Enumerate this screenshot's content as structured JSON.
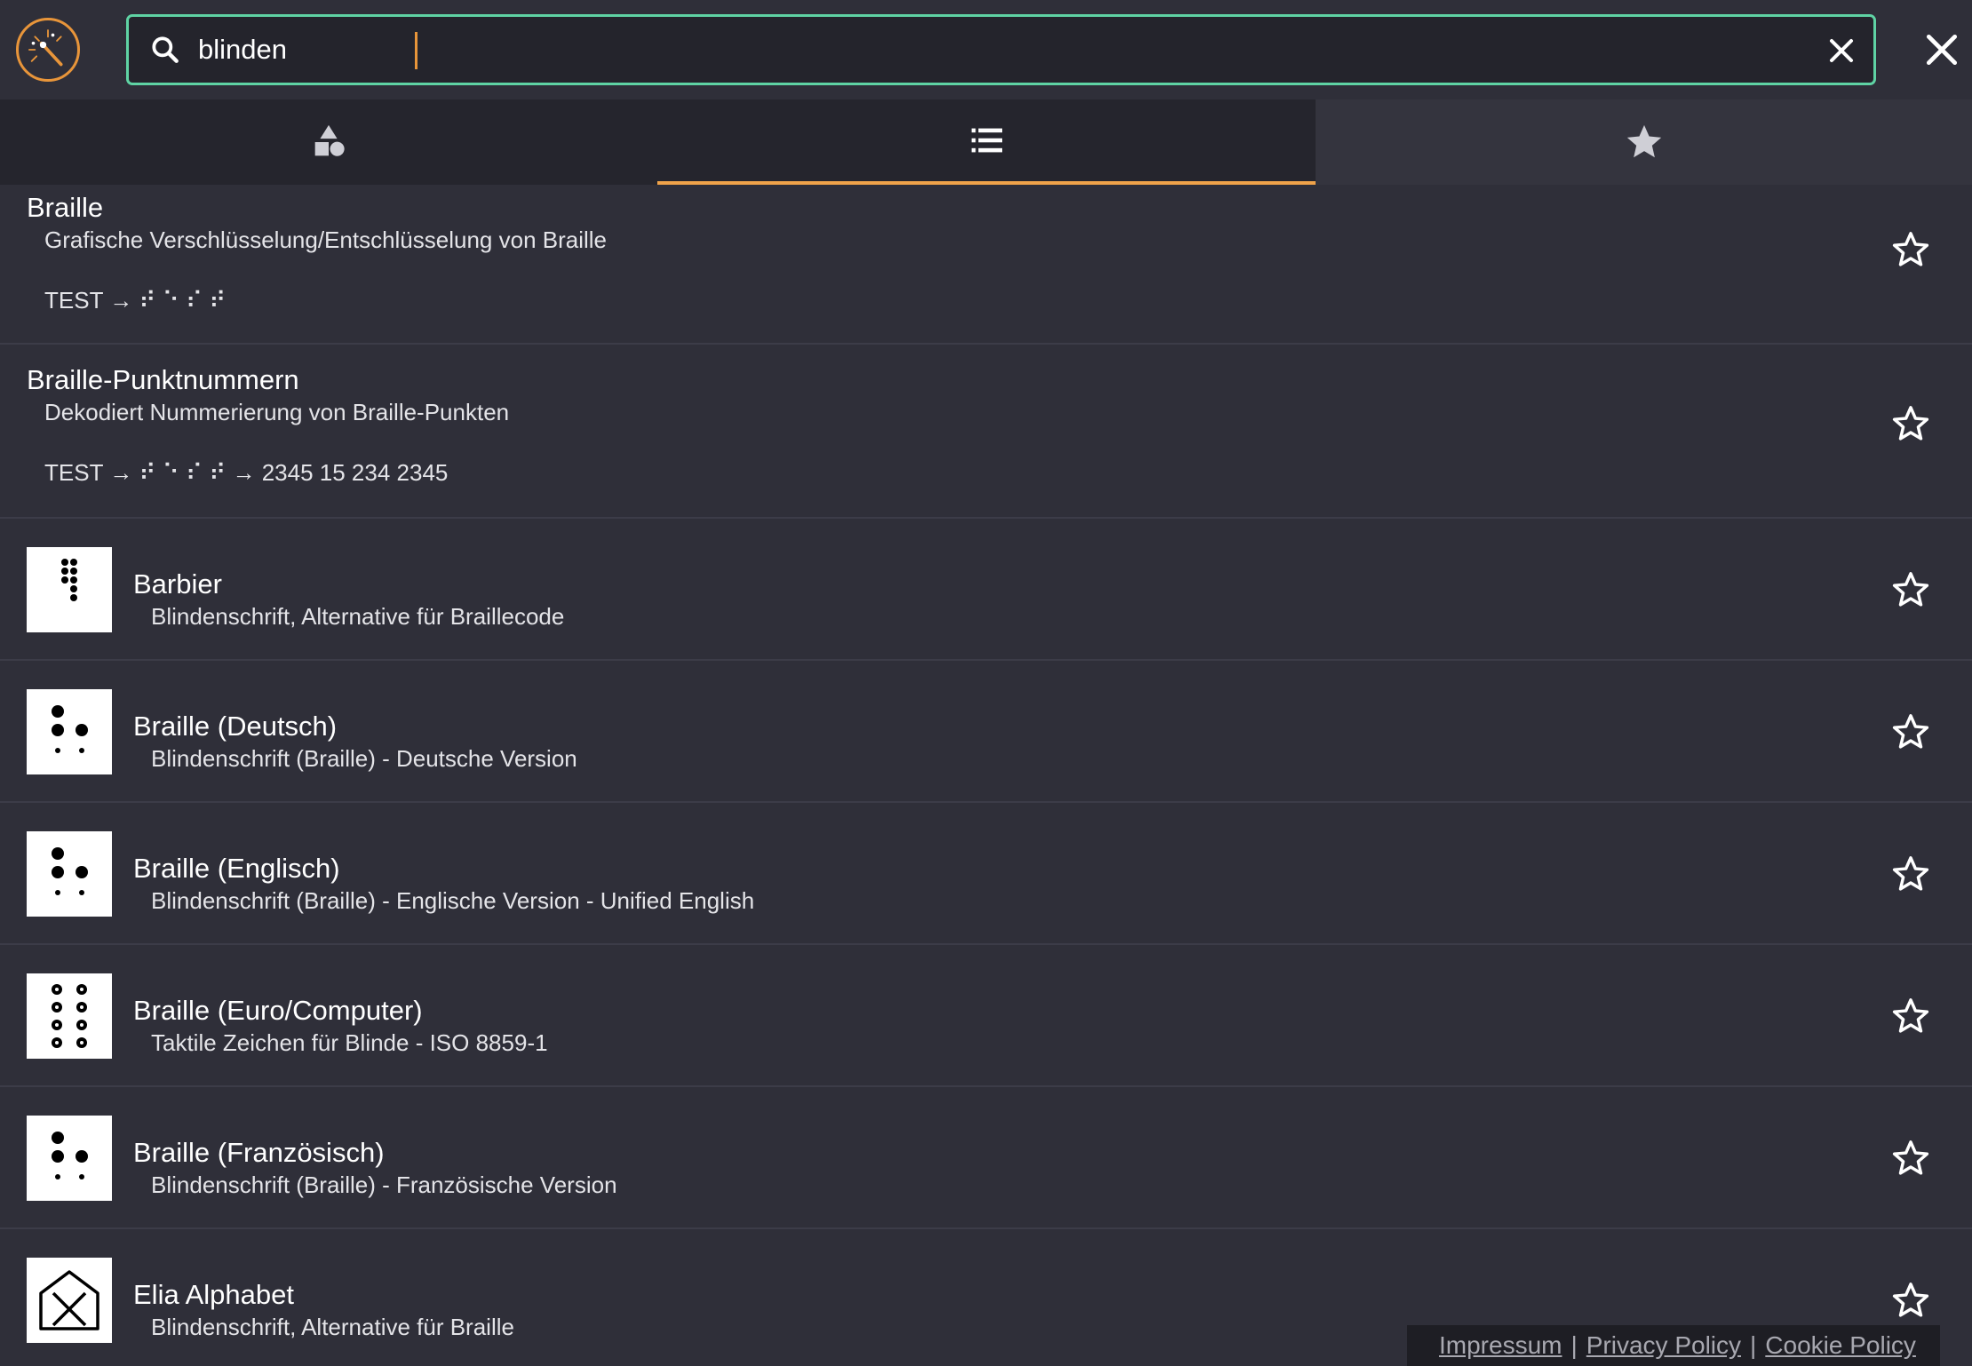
{
  "search": {
    "value": "blinden",
    "icon": "search-icon",
    "clear_icon": "close-icon"
  },
  "close_icon": "close-icon",
  "tabs": [
    {
      "icon": "shapes-icon",
      "active": false
    },
    {
      "icon": "list-icon",
      "active": true
    },
    {
      "icon": "star-filled-icon",
      "active": false
    }
  ],
  "accent_color": "#f0a34a",
  "search_border_color": "#5fd3a4",
  "results": [
    {
      "title": "Braille",
      "description": "Grafische Verschlüsselung/Entschlüsselung von Braille",
      "example": "TEST → ⠞ ⠑ ⠎ ⠞"
    },
    {
      "title": "Braille-Punktnummern",
      "description": "Dekodiert Nummerierung von Braille-Punkten",
      "example": "TEST → ⠞ ⠑ ⠎ ⠞ → 2345 15 234 2345"
    },
    {
      "title": "Barbier",
      "description": "Blindenschrift, Alternative für Braillecode",
      "thumbnail": "barbier-dots-icon"
    },
    {
      "title": "Braille (Deutsch)",
      "description": "Blindenschrift (Braille) - Deutsche Version",
      "thumbnail": "braille-cell-icon"
    },
    {
      "title": "Braille (Englisch)",
      "description": "Blindenschrift (Braille) - Englische Version - Unified English",
      "thumbnail": "braille-cell-icon"
    },
    {
      "title": "Braille (Euro/Computer)",
      "description": "Taktile Zeichen für Blinde - ISO 8859-1",
      "thumbnail": "braille-8dot-icon"
    },
    {
      "title": "Braille (Französisch)",
      "description": "Blindenschrift (Braille) - Französische Version",
      "thumbnail": "braille-cell-icon"
    },
    {
      "title": "Elia Alphabet",
      "description": "Blindenschrift, Alternative für Braille",
      "thumbnail": "elia-house-icon"
    }
  ],
  "footer": {
    "impressum": "Impressum",
    "separator": "|",
    "privacy": "Privacy Policy",
    "cookie": "Cookie Policy"
  }
}
